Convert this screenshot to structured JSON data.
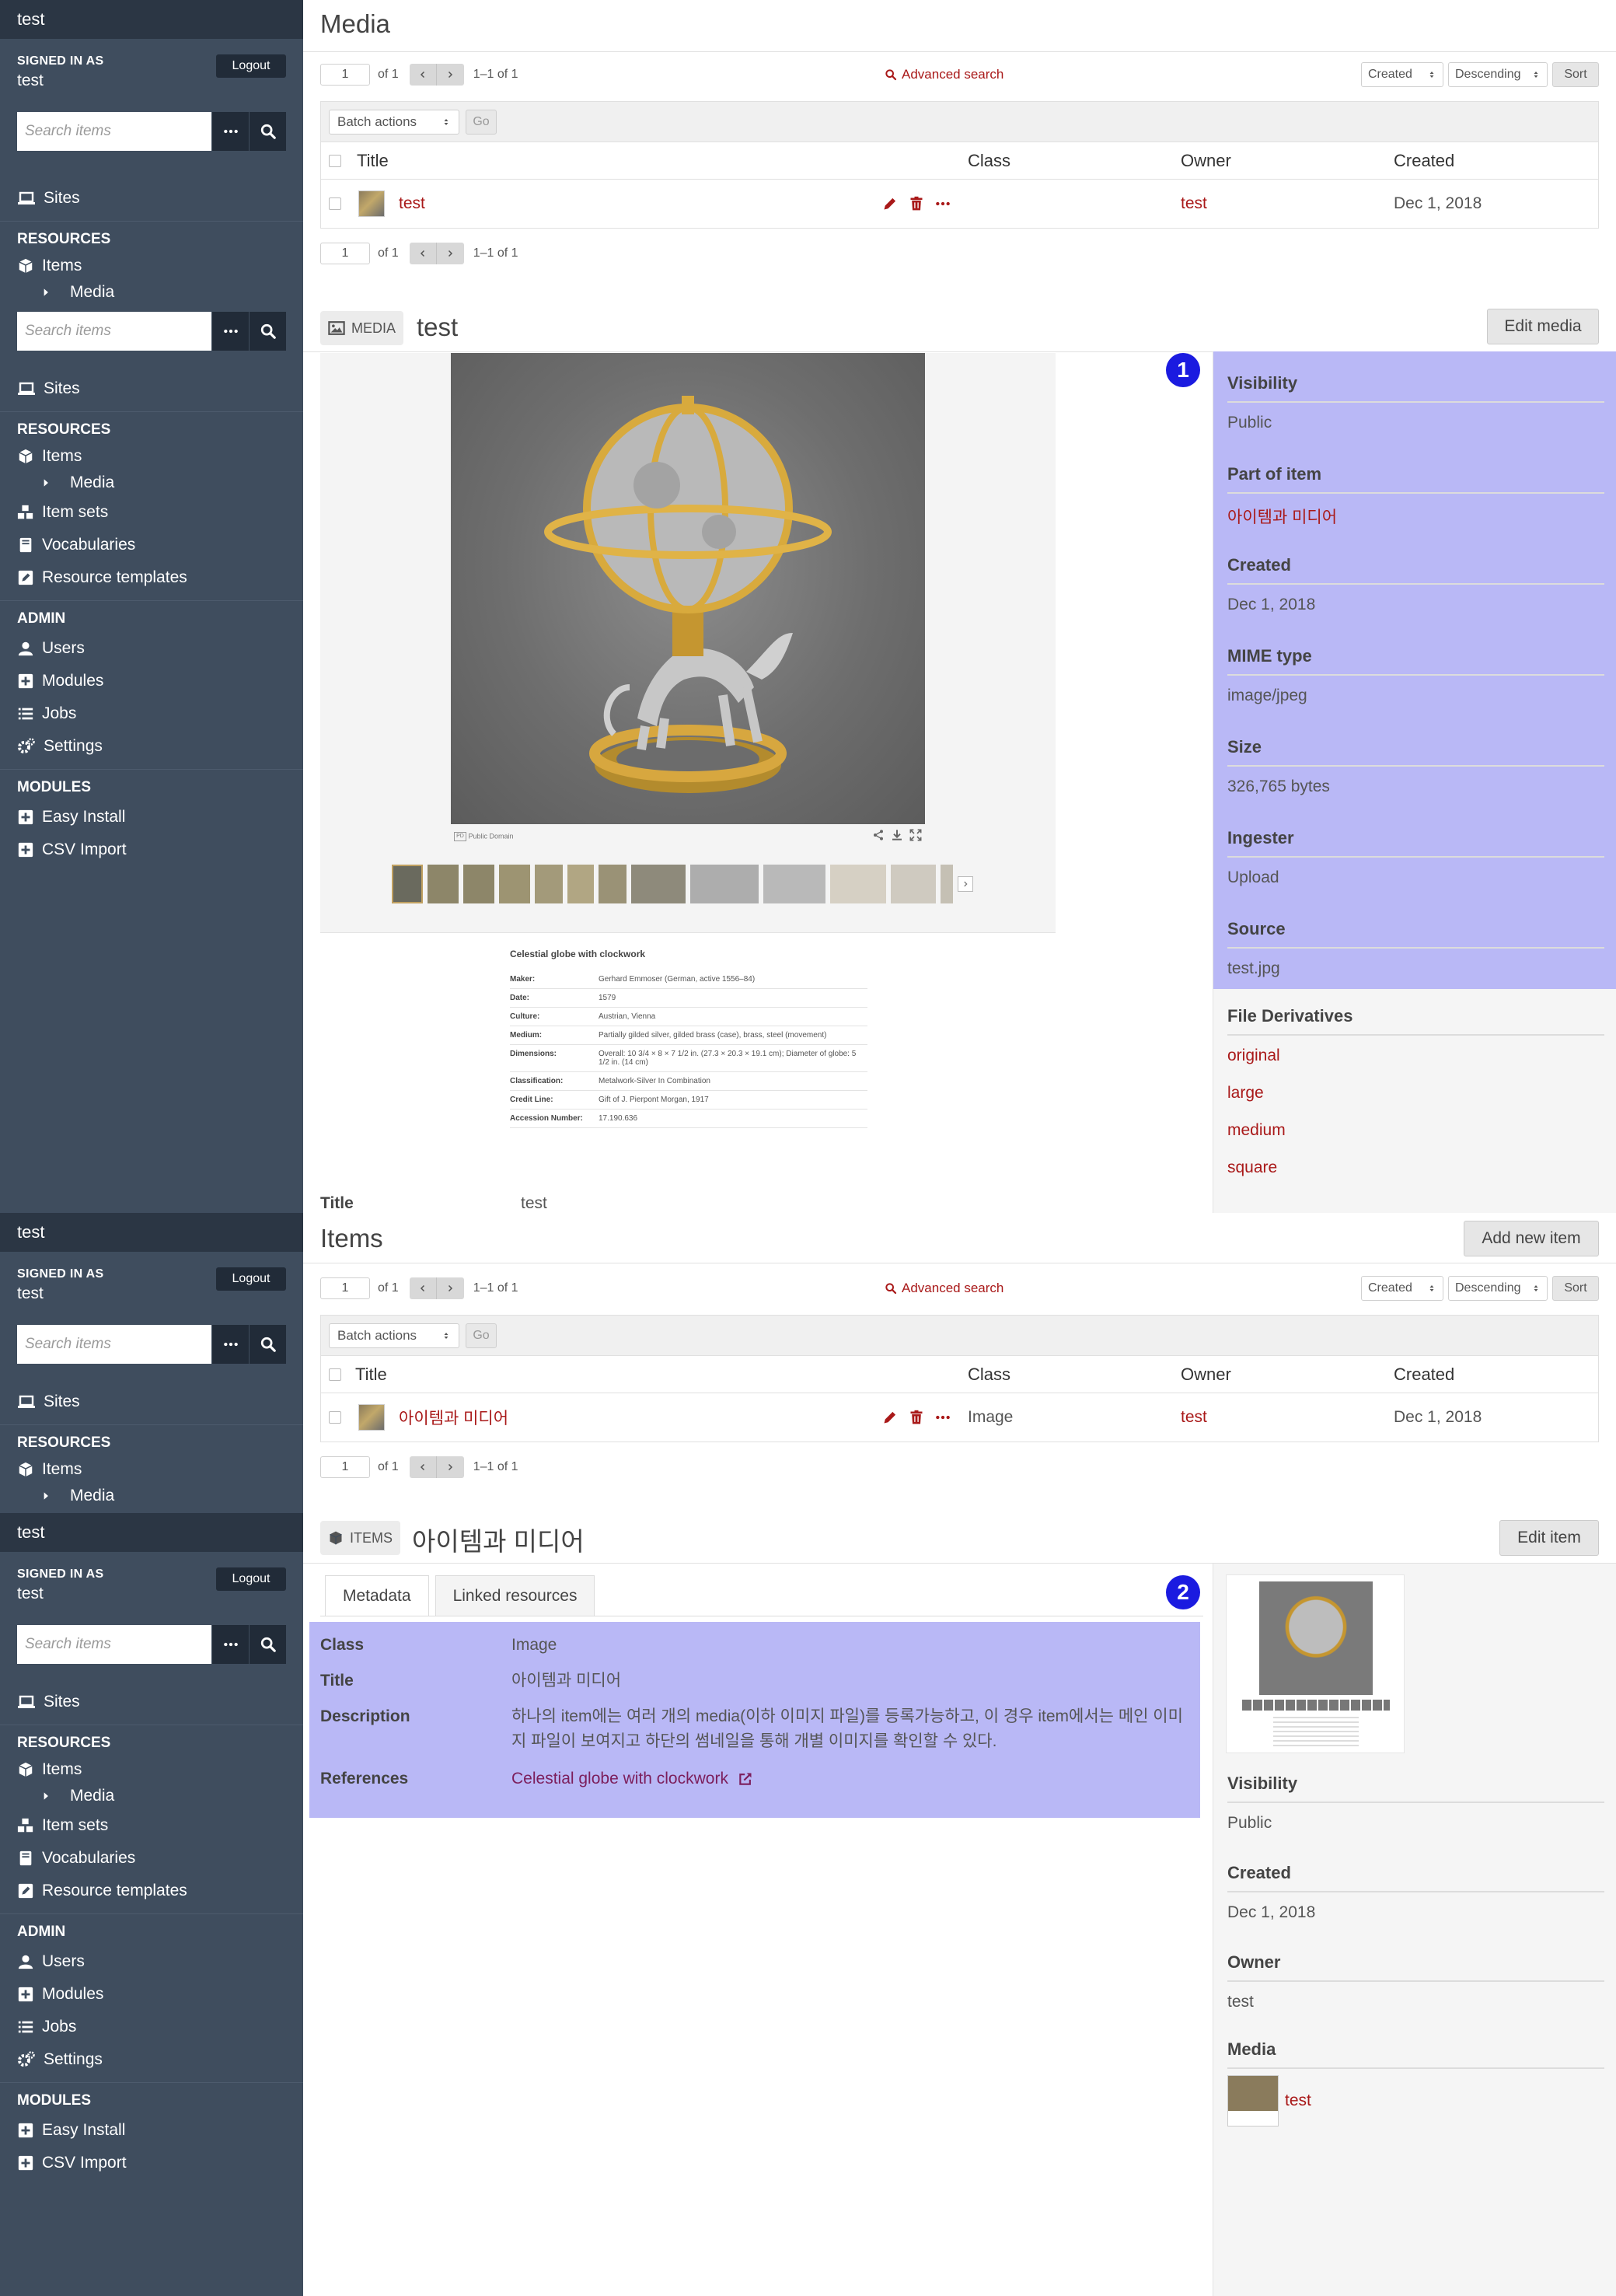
{
  "sidebar": {
    "title": "test",
    "signed_in_as": "SIGNED IN AS",
    "username": "test",
    "logout": "Logout",
    "search_placeholder": "Search items",
    "sites": "Sites",
    "resources_head": "RESOURCES",
    "items": "Items",
    "media": "Media",
    "item_sets": "Item sets",
    "vocabularies": "Vocabularies",
    "resource_templates": "Resource templates",
    "admin_head": "ADMIN",
    "users": "Users",
    "modules": "Modules",
    "jobs": "Jobs",
    "settings": "Settings",
    "modules_head": "MODULES",
    "easy_install": "Easy Install",
    "csv_import": "CSV Import"
  },
  "media_browse": {
    "title": "Media",
    "page_value": "1",
    "of_pages": "of 1",
    "count": "1–1 of 1",
    "advanced_search": "Advanced search",
    "sort_by": "Created",
    "sort_order": "Descending",
    "sort_button": "Sort",
    "batch_actions": "Batch actions",
    "go": "Go",
    "columns": [
      "Title",
      "Class",
      "Owner",
      "Created"
    ],
    "row": {
      "title": "test",
      "class": "",
      "owner": "test",
      "created": "Dec 1, 2018"
    }
  },
  "media_show": {
    "badge_label": "MEDIA",
    "title": "test",
    "edit_button": "Edit media",
    "callout": "1",
    "caption": {
      "heading": "Celestial globe with clockwork",
      "rows": [
        [
          "Maker:",
          "Gerhard Emmoser (German, active 1556–84)"
        ],
        [
          "Date:",
          "1579"
        ],
        [
          "Culture:",
          "Austrian, Vienna"
        ],
        [
          "Medium:",
          "Partially gilded silver, gilded brass (case), brass, steel (movement)"
        ],
        [
          "Dimensions:",
          "Overall: 10 3/4 × 8 × 7 1/2 in. (27.3 × 20.3 × 19.1 cm); Diameter of globe: 5 1/2 in. (14 cm)"
        ],
        [
          "Classification:",
          "Metalwork-Silver In Combination"
        ],
        [
          "Credit Line:",
          "Gift of J. Pierpont Morgan, 1917"
        ],
        [
          "Accession Number:",
          "17.190.636"
        ]
      ],
      "public_domain": "Public Domain"
    },
    "title_label": "Title",
    "title_value": "test",
    "props": [
      {
        "label": "Visibility",
        "value": "Public",
        "link": false
      },
      {
        "label": "Part of item",
        "value": "아이템과 미디어",
        "link": true
      },
      {
        "label": "Created",
        "value": "Dec 1, 2018",
        "link": false
      },
      {
        "label": "MIME type",
        "value": "image/jpeg",
        "link": false
      },
      {
        "label": "Size",
        "value": "326,765 bytes",
        "link": false
      },
      {
        "label": "Ingester",
        "value": "Upload",
        "link": false
      },
      {
        "label": "Source",
        "value": "test.jpg",
        "link": false
      }
    ],
    "derivatives_label": "File Derivatives",
    "derivatives": [
      "original",
      "large",
      "medium",
      "square"
    ]
  },
  "items_browse": {
    "title": "Items",
    "add_button": "Add new item",
    "page_value": "1",
    "of_pages": "of 1",
    "count": "1–1 of 1",
    "advanced_search": "Advanced search",
    "sort_by": "Created",
    "sort_order": "Descending",
    "sort_button": "Sort",
    "batch_actions": "Batch actions",
    "go": "Go",
    "columns": [
      "Title",
      "Class",
      "Owner",
      "Created"
    ],
    "row": {
      "title": "아이템과 미디어",
      "class": "Image",
      "owner": "test",
      "created": "Dec 1, 2018"
    }
  },
  "item_show": {
    "badge_label": "ITEMS",
    "title": "아이템과 미디어",
    "edit_button": "Edit item",
    "callout": "2",
    "tabs": [
      "Metadata",
      "Linked resources"
    ],
    "metadata": [
      {
        "label": "Class",
        "value": "Image"
      },
      {
        "label": "Title",
        "value": "아이템과 미디어"
      },
      {
        "label": "Description",
        "value": "하나의 item에는 여러 개의 media(이하 이미지 파일)를 등록가능하고, 이 경우 item에서는 메인 이미지 파일이 보여지고 하단의 썸네일을 통해 개별 이미지를 확인할 수 있다."
      },
      {
        "label": "References",
        "value": "Celestial globe with clockwork"
      }
    ],
    "props": [
      {
        "label": "Visibility",
        "value": "Public"
      },
      {
        "label": "Created",
        "value": "Dec 1, 2018"
      },
      {
        "label": "Owner",
        "value": "test"
      }
    ],
    "media_label": "Media",
    "media_link": "test"
  },
  "colors": {
    "sidebar": "#3f4d5e",
    "sidebar_dark": "#2b3644",
    "link": "#a91919",
    "highlight": "#b9b8f6",
    "callout": "#1b1be0"
  }
}
